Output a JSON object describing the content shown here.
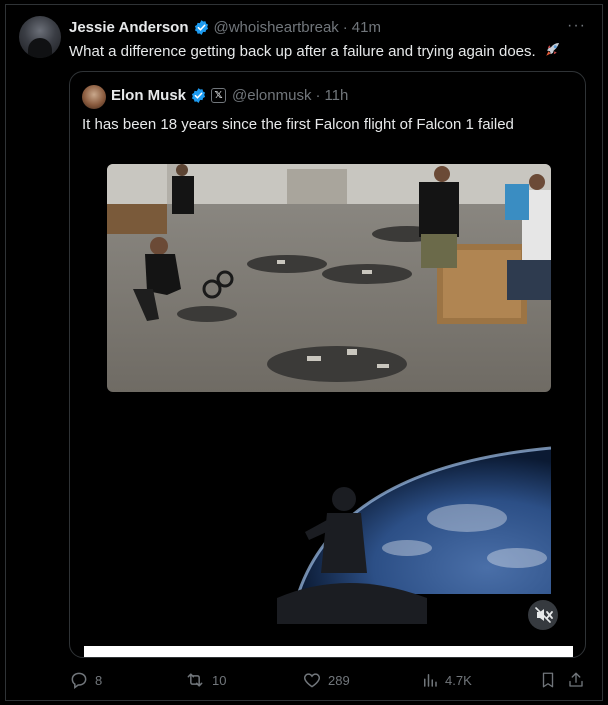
{
  "tweet": {
    "author_name": "Jessie Anderson",
    "author_handle": "@whoisheartbreak",
    "separator": "·",
    "time": "41m",
    "more_label": "···",
    "text": "What a difference getting back up after a failure and trying again does.",
    "emoji": "rocket-icon"
  },
  "quote": {
    "author_name": "Elon Musk",
    "author_handle": "@elonmusk",
    "separator": "·",
    "time": "11h",
    "text": "It has been 18 years since the first Falcon flight of Falcon 1 failed"
  },
  "actions": {
    "replies": "8",
    "reposts": "10",
    "likes": "289",
    "views": "4.7K"
  },
  "colors": {
    "background": "#000000",
    "text": "#e7e9ea",
    "muted": "#71767b",
    "border": "#2f3336",
    "verified": "#1d9bf0"
  }
}
